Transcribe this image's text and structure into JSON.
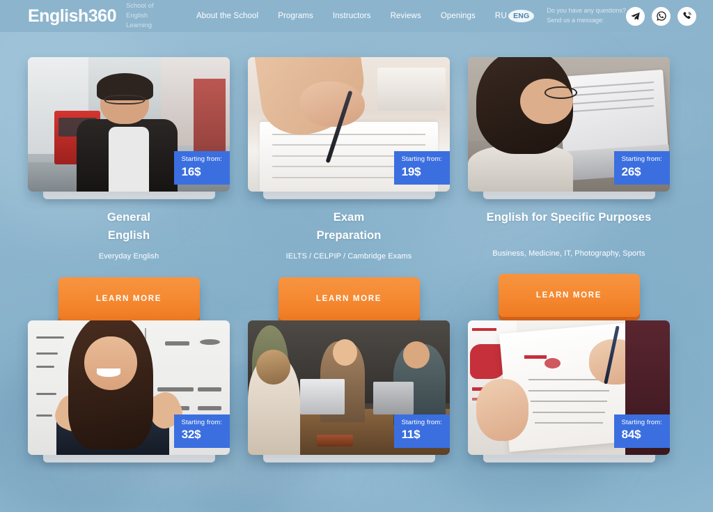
{
  "header": {
    "brand": "English360",
    "brand_subtitle": "School of English Learning",
    "nav_items": [
      {
        "label": "About the School"
      },
      {
        "label": "Programs"
      },
      {
        "label": "Instructors"
      },
      {
        "label": "Reviews"
      },
      {
        "label": "Openings"
      }
    ],
    "lang": {
      "inactive": "RU",
      "active": "ENG"
    },
    "contact_prompt_line1": "Do you have any questions?",
    "contact_prompt_line2": "Send us a message:",
    "socials": [
      {
        "name": "telegram-icon"
      },
      {
        "name": "whatsapp-icon"
      },
      {
        "name": "viber-icon"
      }
    ]
  },
  "price_label": "Starting from:",
  "cta_label": "LEARN MORE",
  "cards": [
    {
      "title": "General\nEnglish",
      "subtitle": "Everyday English",
      "price": "16$",
      "has_text": true
    },
    {
      "title": "Exam\nPreparation",
      "subtitle": "IELTS / CELPIP / Cambridge Exams",
      "price": "19$",
      "has_text": true
    },
    {
      "title": "English for Specific Purposes",
      "subtitle": "Business, Medicine, IT, Photography, Sports",
      "price": "26$",
      "has_text": true
    },
    {
      "title": "",
      "subtitle": "",
      "price": "32$",
      "has_text": false
    },
    {
      "title": "",
      "subtitle": "",
      "price": "11$",
      "has_text": false
    },
    {
      "title": "",
      "subtitle": "",
      "price": "84$",
      "has_text": false
    }
  ],
  "colors": {
    "page_background": "#8cb4cd",
    "header_background": "#8cb4cd",
    "price_badge": "#3b6fe0",
    "cta_gradient_top": "#f79440",
    "cta_gradient_bottom": "#ef7a22",
    "cta_shadow": "#d4621a",
    "text_on_blue": "#ffffff"
  }
}
